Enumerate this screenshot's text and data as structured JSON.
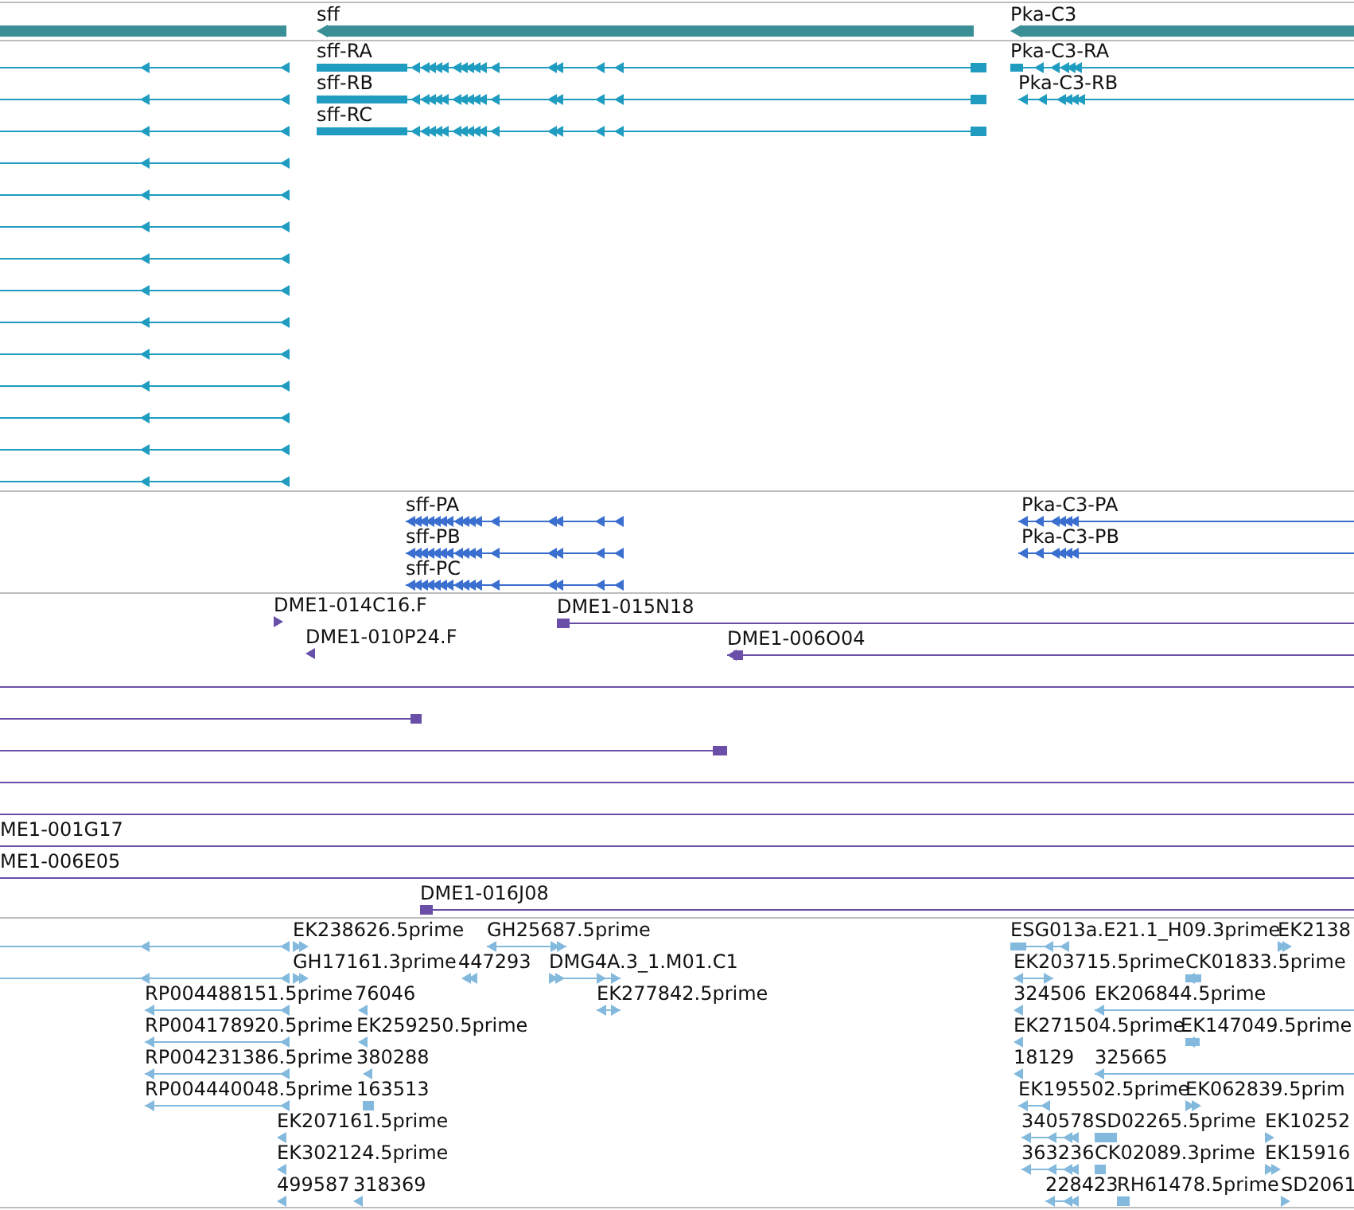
{
  "tracks": [
    {
      "color": "#3a8f96",
      "labels": [
        "sff",
        "Pka-C3"
      ]
    },
    {
      "color": "#1f9cc0",
      "labels": [
        "sff-RA",
        "sff-RB",
        "sff-RC",
        "Pka-C3-RA",
        "Pka-C3-RB"
      ]
    },
    {
      "color": "#3a6fd0",
      "labels": [
        "sff-PA",
        "sff-PB",
        "sff-PC",
        "Pka-C3-PA",
        "Pka-C3-PB"
      ]
    },
    {
      "color": "#6a4fa8",
      "labels": [
        "DME1-014C16.F",
        "DME1-015N18",
        "DME1-010P24.F",
        "DME1-006O04",
        "ME1-001G17",
        "ME1-006E05",
        "DME1-016J08"
      ]
    },
    {
      "color": "#82b9dd",
      "labels": [
        "EK238626.5prime",
        "GH25687.5prime",
        "ESG013a.E21.1_H09.3prime",
        "EK2138",
        "GH17161.3prime",
        "447293",
        "DMG4A.3_1.M01.C1",
        "EK203715.5prime",
        "CK01833.5prime",
        "RP004488151.5prime",
        "76046",
        "EK277842.5prime",
        "324506",
        "EK206844.5prime",
        "RP004178920.5prime",
        "EK259250.5prime",
        "EK271504.5prime",
        "EK147049.5prime",
        "RP004231386.5prime",
        "380288",
        "18129",
        "325665",
        "RP004440048.5prime",
        "163513",
        "EK195502.5prime",
        "EK062839.5prim",
        "EK207161.5prime",
        "340578",
        "SD02265.5prime",
        "EK10252",
        "EK302124.5prime",
        "363236",
        "CK02089.3prime",
        "EK15916",
        "499587",
        "318369",
        "228423",
        "RH61478.5prime",
        "SD2061"
      ]
    }
  ]
}
